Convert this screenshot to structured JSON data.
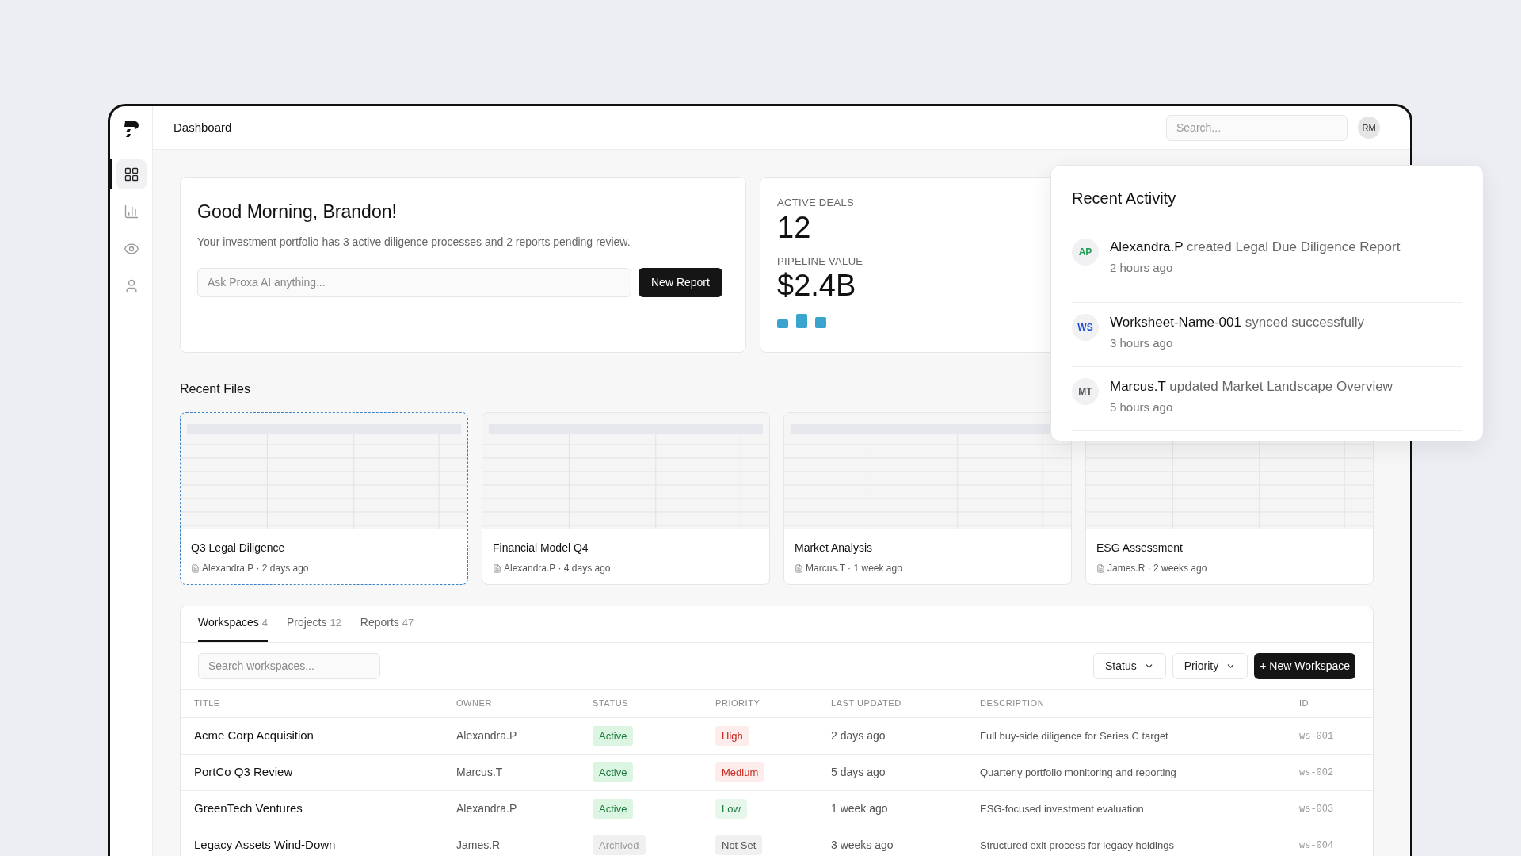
{
  "header": {
    "title": "Dashboard",
    "search": {
      "placeholder": "Search..."
    },
    "avatar": "RM"
  },
  "sidebar": {
    "items": [
      {
        "kind": "grid",
        "selected": true
      },
      {
        "kind": "chart",
        "selected": false
      },
      {
        "kind": "eye",
        "selected": false
      },
      {
        "kind": "user",
        "selected": false
      }
    ]
  },
  "greeting": {
    "title": "Good Morning, Brandon!",
    "text": "Your investment portfolio has 3 active diligence processes and 2 reports pending review.",
    "ask": {
      "placeholder": "Ask Proxa AI anything..."
    },
    "button": "New Report"
  },
  "stats": [
    {
      "label": "ACTIVE DEALS",
      "value": "12"
    },
    {
      "label": "PIPELINE VALUE",
      "value": "$2.4B"
    }
  ],
  "recent_activity": {
    "title": "Recent Activity",
    "items": [
      {
        "initials": "AP",
        "color": "#1f9d55",
        "who": "Alexandra.P",
        "action": "created Legal Due Diligence Report",
        "time": "2 hours ago"
      },
      {
        "initials": "WS",
        "color": "#1d4ed8",
        "who": "Worksheet-Name-001",
        "action": "synced successfully",
        "time": "3 hours ago"
      },
      {
        "initials": "MT",
        "color": "#555555",
        "who": "Marcus.T",
        "action": "updated Market Landscape Overview",
        "time": "5 hours ago"
      }
    ]
  },
  "recent_files": {
    "title": "Recent Files",
    "items": [
      {
        "name": "Q3 Legal Diligence",
        "meta": "Alexandra.P · 2 days ago",
        "selected": true
      },
      {
        "name": "Financial Model Q4",
        "meta": "Alexandra.P · 4 days ago",
        "selected": false
      },
      {
        "name": "Market Analysis",
        "meta": "Marcus.T · 1 week ago",
        "selected": false
      },
      {
        "name": "ESG Assessment",
        "meta": "James.R · 2 weeks ago",
        "selected": false
      }
    ]
  },
  "tabs": [
    {
      "label": "Workspaces",
      "count": "4",
      "selected": true
    },
    {
      "label": "Projects",
      "count": "12",
      "selected": false
    },
    {
      "label": "Reports",
      "count": "47",
      "selected": false
    }
  ],
  "toolbar": {
    "search": {
      "placeholder": "Search workspaces..."
    },
    "filters": [
      "Status",
      "Priority"
    ],
    "button": "+ New Workspace"
  },
  "table": {
    "columns": [
      "TITLE",
      "OWNER",
      "STATUS",
      "PRIORITY",
      "LAST UPDATED",
      "DESCRIPTION",
      "ID"
    ],
    "rows": [
      {
        "title": "Acme Corp Acquisition",
        "owner": "Alexandra.P",
        "status": {
          "text": "Active",
          "kind": "active"
        },
        "priority": {
          "text": "High",
          "kind": "high"
        },
        "updated": "2 days ago",
        "description": "Full buy-side diligence for Series C target",
        "id": "ws-001"
      },
      {
        "title": "PortCo Q3 Review",
        "owner": "Marcus.T",
        "status": {
          "text": "Active",
          "kind": "active"
        },
        "priority": {
          "text": "Medium",
          "kind": "medium"
        },
        "updated": "5 days ago",
        "description": "Quarterly portfolio monitoring and reporting",
        "id": "ws-002"
      },
      {
        "title": "GreenTech Ventures",
        "owner": "Alexandra.P",
        "status": {
          "text": "Active",
          "kind": "active"
        },
        "priority": {
          "text": "Low",
          "kind": "low"
        },
        "updated": "1 week ago",
        "description": "ESG-focused investment evaluation",
        "id": "ws-003"
      },
      {
        "title": "Legacy Assets Wind-Down",
        "owner": "James.R",
        "status": {
          "text": "Archived",
          "kind": "archived"
        },
        "priority": {
          "text": "Not Set",
          "kind": "none"
        },
        "updated": "3 weeks ago",
        "description": "Structured exit process for legacy holdings",
        "id": "ws-004"
      }
    ]
  }
}
